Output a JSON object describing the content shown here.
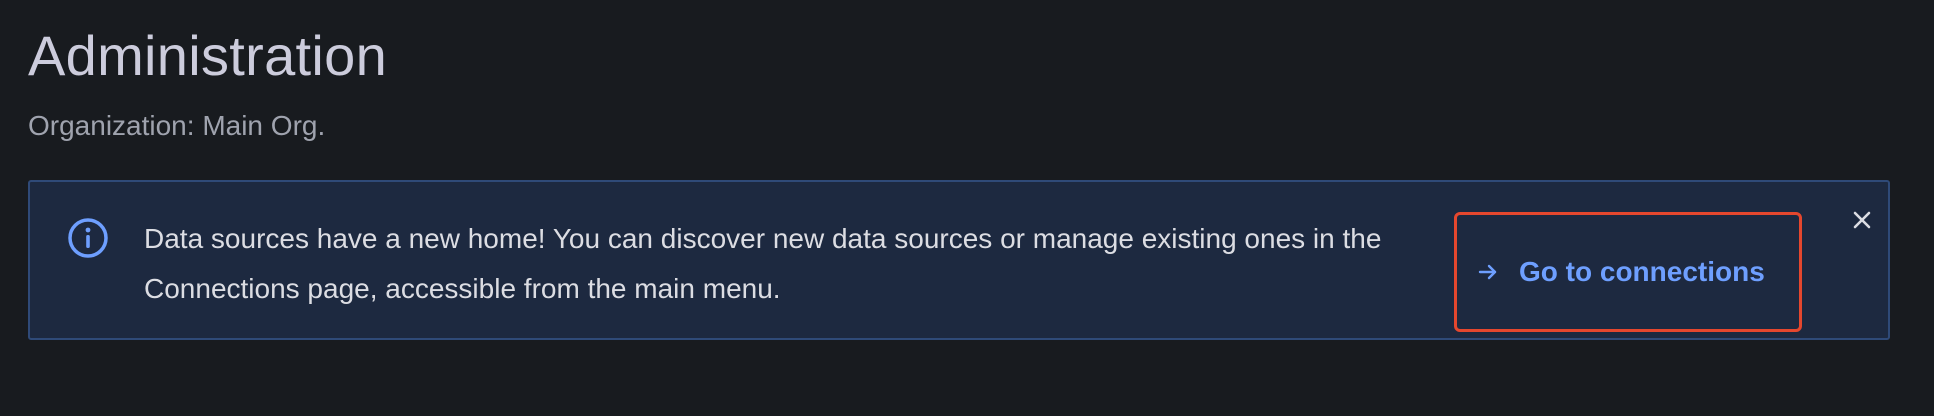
{
  "header": {
    "title": "Administration",
    "subtitle": "Organization: Main Org."
  },
  "alert": {
    "severity": "info",
    "icon": "info-circle-icon",
    "message": "Data sources have a new home! You can discover new data sources or manage existing ones in the Connections page, accessible from the main menu.",
    "action_label": "Go to connections",
    "action_icon": "arrow-right-icon",
    "close_icon": "close-icon"
  },
  "colors": {
    "background": "#181b1f",
    "alert_background": "#1d2940",
    "alert_border": "#2f4a78",
    "accent": "#6e9fff",
    "highlight": "#e5472e"
  }
}
